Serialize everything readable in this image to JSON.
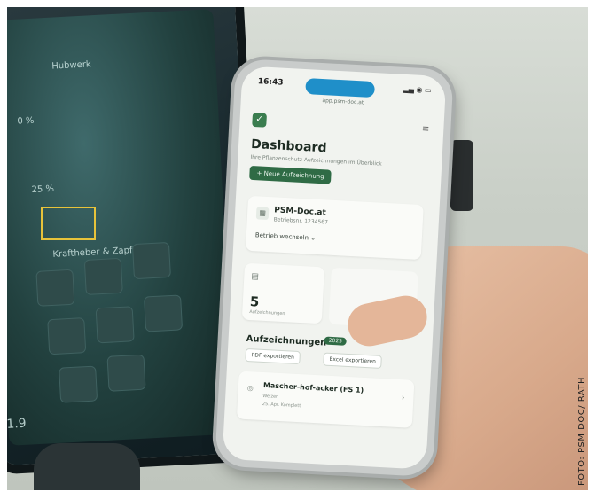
{
  "photo_credit": "FOTO: PSM DOC/ RATH",
  "terminal": {
    "label_top": "Hubwerk",
    "label_section": "Kraftheber & Zapfwelle",
    "value_1": "0 %",
    "value_2": "25 %",
    "value_bottom": "1.9"
  },
  "phone": {
    "time": "16:43",
    "url": "app.psm-doc.at",
    "logo_glyph": "✓",
    "menu_glyph": "≡",
    "title": "Dashboard",
    "subtitle": "Ihre Pflanzenschutz-Aufzeichnungen im Überblick",
    "new_button": "+ Neue Aufzeichnung",
    "business": {
      "name": "PSM-Doc.at",
      "id": "Betriebsnr. 1234567",
      "switch_button": "Betrieb wechseln ⌄"
    },
    "stat": {
      "value": "5",
      "label": "Aufzeichnungen"
    },
    "records": {
      "title": "Aufzeichnungen",
      "year_badge": "2025",
      "pdf_button": "PDF exportieren",
      "excel_button": "Excel exportieren",
      "entry_name": "Mascher-hof-acker (FS 1)",
      "entry_sub1": "Weizen",
      "entry_sub2": "25. Apr.   Komplett"
    }
  }
}
